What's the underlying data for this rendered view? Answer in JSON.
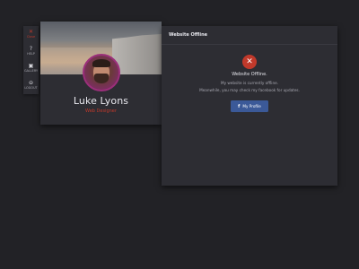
{
  "sidebar": {
    "items": [
      {
        "icon": "close-icon",
        "glyph": "✕",
        "label": "Close"
      },
      {
        "icon": "help-icon",
        "glyph": "?",
        "label": "HELP"
      },
      {
        "icon": "gallery-icon",
        "glyph": "▣",
        "label": "GALLERY"
      },
      {
        "icon": "logout-icon",
        "glyph": "⊖",
        "label": "LOGOUT"
      }
    ]
  },
  "profile": {
    "name": "Luke Lyons",
    "role": "Web Designer"
  },
  "panel": {
    "title": "Website Offline",
    "status_glyph": "✕",
    "status_title": "Website Offline.",
    "message_line1": "My website is currently offline.",
    "message_line2": "Meanwhile, you may check my facebook for updates.",
    "button_icon_glyph": "f",
    "button_label": "My Profile",
    "button_color": "#3b5998",
    "accent_color": "#c0392b"
  }
}
